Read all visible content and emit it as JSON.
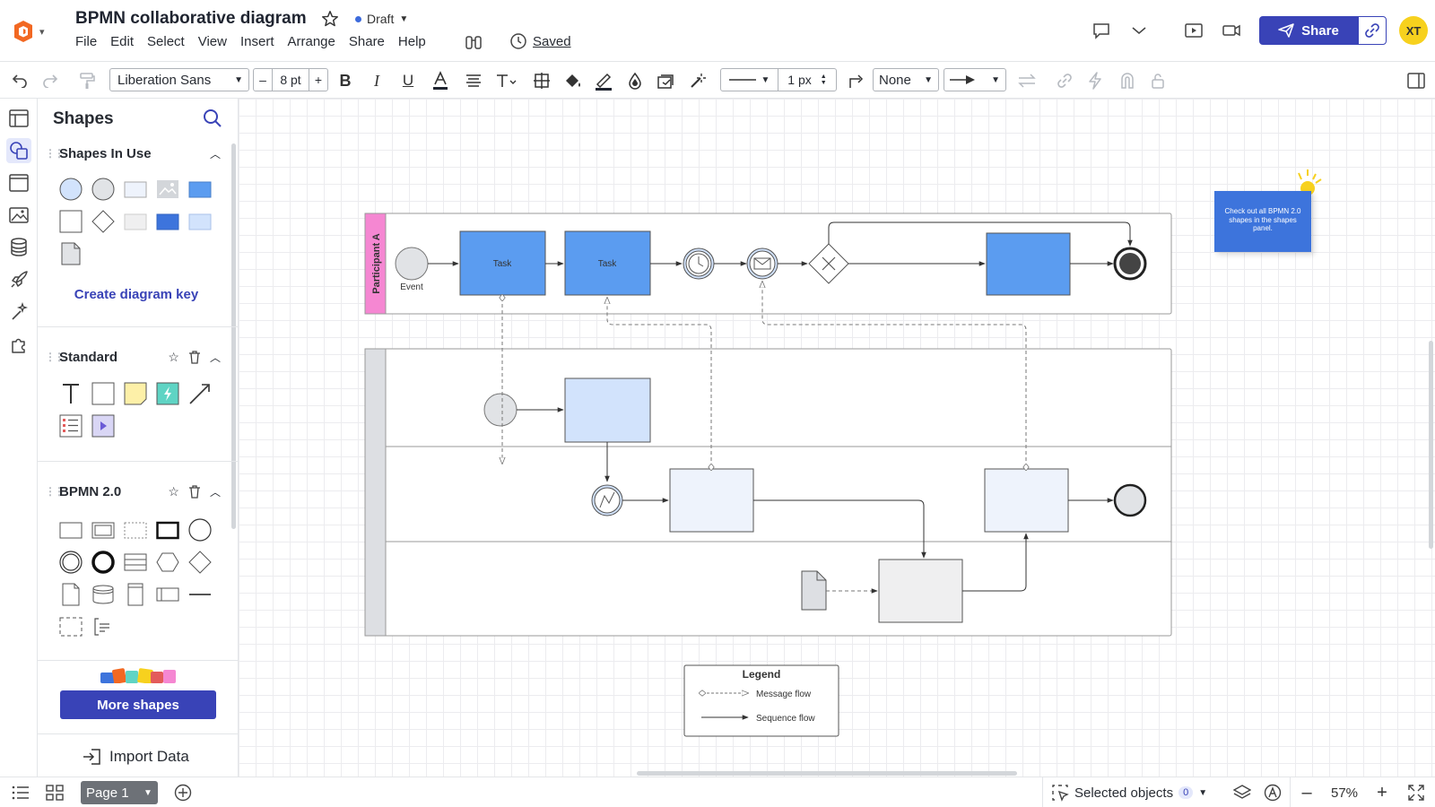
{
  "header": {
    "title": "BPMN collaborative diagram",
    "status": "Draft",
    "saved": "Saved",
    "share": "Share",
    "avatar": "XT",
    "menu": [
      "File",
      "Edit",
      "Select",
      "View",
      "Insert",
      "Arrange",
      "Share",
      "Help"
    ]
  },
  "toolbar": {
    "font": "Liberation Sans",
    "font_size": "8 pt",
    "line_width": "1 px",
    "line_start": "None",
    "decrease": "–",
    "increase": "+"
  },
  "panel": {
    "title": "Shapes",
    "sections": {
      "in_use": "Shapes In Use",
      "standard": "Standard",
      "bpmn": "BPMN 2.0"
    },
    "diagram_key": "Create diagram key",
    "more_shapes": "More shapes",
    "import_data": "Import Data"
  },
  "canvas": {
    "participant_label": "Participant A",
    "event_label": "Event",
    "task_label": "Task",
    "callout_text": "Check out all BPMN 2.0 shapes in the shapes panel.",
    "legend": {
      "title": "Legend",
      "message_flow": "Message flow",
      "sequence_flow": "Sequence flow"
    }
  },
  "bottombar": {
    "page": "Page 1",
    "selected_objects": "Selected objects",
    "selected_count": "0",
    "zoom": "57%"
  },
  "colors": {
    "primary": "#3943b7",
    "task_blue": "#5b9cf0",
    "light_blue": "#d2e3fc",
    "participant_pink": "#f587d2",
    "avatar": "#f7d11e"
  }
}
